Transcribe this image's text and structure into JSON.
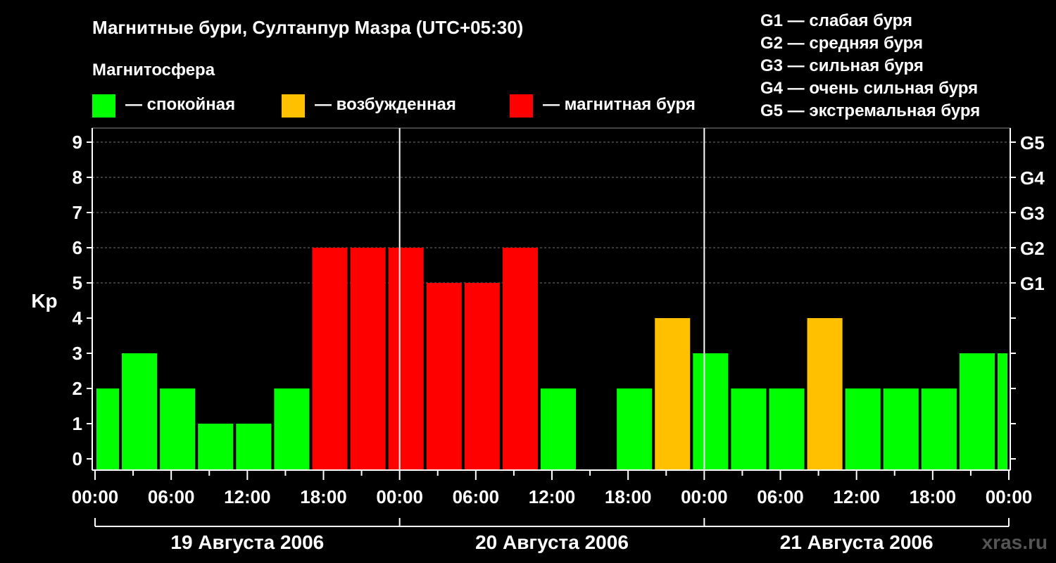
{
  "title": "Магнитные бури, Султанпур Мазра (UTC+05:30)",
  "subtitle": "Магнитосфера",
  "legend": [
    {
      "label": "— спокойная",
      "color": "#00ff00"
    },
    {
      "label": "— возбужденная",
      "color": "#ffc000"
    },
    {
      "label": "— магнитная буря",
      "color": "#ff0000"
    }
  ],
  "storm_scale": [
    "G1 — слабая буря",
    "G2 — средняя буря",
    "G3 — сильная буря",
    "G4 — очень сильная буря",
    "G5 — экстремальная буря"
  ],
  "watermark": "xras.ru",
  "chart_data": {
    "type": "bar",
    "ylabel": "Kp",
    "ylim": [
      0,
      9
    ],
    "yticks": [
      "0",
      "1",
      "2",
      "3",
      "4",
      "5",
      "6",
      "7",
      "8",
      "9"
    ],
    "right_axis": [
      {
        "label": "G1",
        "kp": 5
      },
      {
        "label": "G2",
        "kp": 6
      },
      {
        "label": "G3",
        "kp": 7
      },
      {
        "label": "G4",
        "kp": 8
      },
      {
        "label": "G5",
        "kp": 9
      }
    ],
    "x_hours_range": [
      0,
      72
    ],
    "xtick_labels": [
      "00:00",
      "06:00",
      "12:00",
      "18:00",
      "00:00",
      "06:00",
      "12:00",
      "18:00",
      "00:00",
      "06:00",
      "12:00",
      "18:00",
      "00:00"
    ],
    "days": [
      "19 Августа 2006",
      "20 Августа 2006",
      "21 Августа 2006"
    ],
    "colors": {
      "calm": "#00ff00",
      "active": "#ffc000",
      "storm": "#ff0000"
    },
    "bars": [
      {
        "start": 0,
        "end": 2,
        "kp": 2,
        "level": "calm"
      },
      {
        "start": 2,
        "end": 5,
        "kp": 3,
        "level": "calm"
      },
      {
        "start": 5,
        "end": 8,
        "kp": 2,
        "level": "calm"
      },
      {
        "start": 8,
        "end": 11,
        "kp": 1,
        "level": "calm"
      },
      {
        "start": 11,
        "end": 14,
        "kp": 1,
        "level": "calm"
      },
      {
        "start": 14,
        "end": 17,
        "kp": 2,
        "level": "calm"
      },
      {
        "start": 17,
        "end": 20,
        "kp": 6,
        "level": "storm"
      },
      {
        "start": 20,
        "end": 23,
        "kp": 6,
        "level": "storm"
      },
      {
        "start": 23,
        "end": 26,
        "kp": 6,
        "level": "storm"
      },
      {
        "start": 26,
        "end": 29,
        "kp": 5,
        "level": "storm"
      },
      {
        "start": 29,
        "end": 32,
        "kp": 5,
        "level": "storm"
      },
      {
        "start": 32,
        "end": 35,
        "kp": 6,
        "level": "storm"
      },
      {
        "start": 35,
        "end": 38,
        "kp": 2,
        "level": "calm"
      },
      {
        "start": 41,
        "end": 44,
        "kp": 2,
        "level": "calm"
      },
      {
        "start": 44,
        "end": 47,
        "kp": 4,
        "level": "active"
      },
      {
        "start": 47,
        "end": 50,
        "kp": 3,
        "level": "calm"
      },
      {
        "start": 50,
        "end": 53,
        "kp": 2,
        "level": "calm"
      },
      {
        "start": 53,
        "end": 56,
        "kp": 2,
        "level": "calm"
      },
      {
        "start": 56,
        "end": 59,
        "kp": 4,
        "level": "active"
      },
      {
        "start": 59,
        "end": 62,
        "kp": 2,
        "level": "calm"
      },
      {
        "start": 62,
        "end": 65,
        "kp": 2,
        "level": "calm"
      },
      {
        "start": 65,
        "end": 68,
        "kp": 2,
        "level": "calm"
      },
      {
        "start": 68,
        "end": 71,
        "kp": 3,
        "level": "calm"
      },
      {
        "start": 71,
        "end": 72,
        "kp": 3,
        "level": "calm"
      }
    ]
  }
}
